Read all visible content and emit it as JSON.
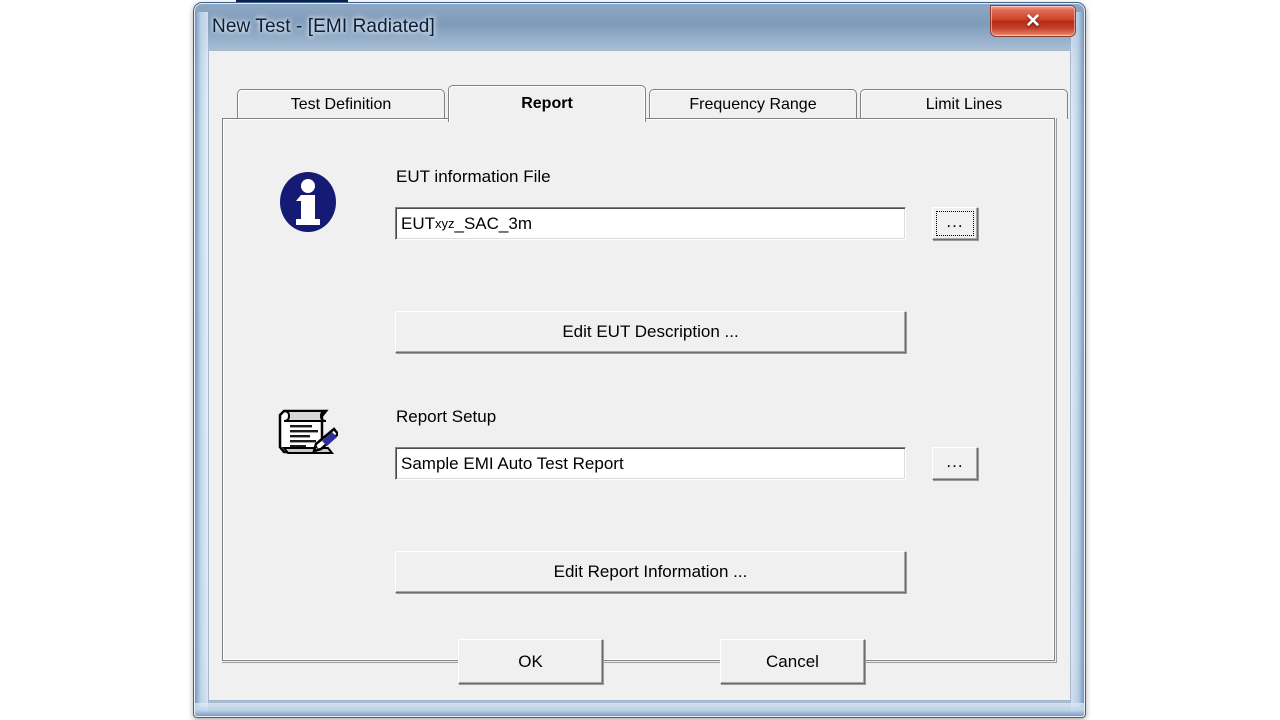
{
  "window": {
    "title": "New Test - [EMI Radiated]",
    "close_label": "✕",
    "close_icon": "close-icon"
  },
  "tabs": [
    {
      "label": "Test Definition",
      "selected": false
    },
    {
      "label": "Report",
      "selected": true
    },
    {
      "label": "Frequency Range",
      "selected": false
    },
    {
      "label": "Limit Lines",
      "selected": false
    }
  ],
  "eut_section": {
    "icon": "info-icon",
    "label": "EUT information File",
    "file_value": "EUTxyz_SAC_3m",
    "file_value_prefix": "EUT",
    "file_value_small": "xyz",
    "file_value_suffix": "_SAC_3m",
    "browse_label": "...",
    "edit_button_label": "Edit EUT Description ..."
  },
  "report_section": {
    "icon": "report-pen-icon",
    "label": "Report Setup",
    "setup_value": "Sample EMI Auto Test Report",
    "browse_label": "...",
    "edit_button_label": "Edit Report Information ..."
  },
  "footer": {
    "ok_label": "OK",
    "cancel_label": "Cancel"
  },
  "colors": {
    "dialog_face": "#f0f0f0",
    "title_text": "#0c1f38",
    "close_red": "#cf4228",
    "info_blue": "#151b74",
    "field_white": "#ffffff"
  }
}
